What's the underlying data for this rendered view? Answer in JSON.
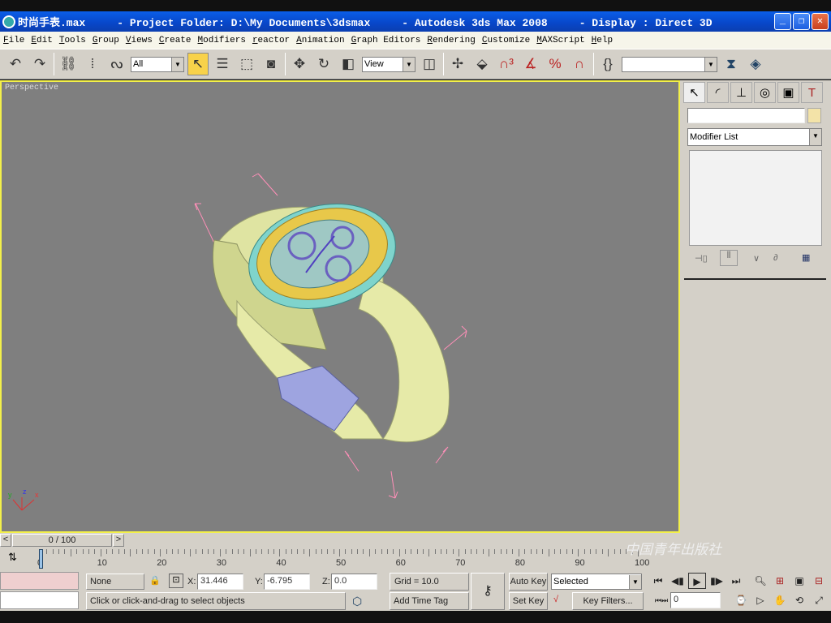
{
  "title_bar": {
    "title": "时尚手表.max     - Project Folder: D:\\My Documents\\3dsmax     - Autodesk 3ds Max 2008     - Display : Direct 3D",
    "minimize": "_",
    "restore": "❐",
    "close": "✕"
  },
  "menu": [
    "File",
    "Edit",
    "Tools",
    "Group",
    "Views",
    "Create",
    "Modifiers",
    "reactor",
    "Animation",
    "Graph Editors",
    "Rendering",
    "Customize",
    "MAXScript",
    "Help"
  ],
  "toolbar": {
    "selection_filter": "All",
    "reference_coord": "View",
    "named_selection": ""
  },
  "viewport": {
    "label": "Perspective",
    "axis": {
      "x": "x",
      "y": "y",
      "z": "z"
    }
  },
  "command_panel": {
    "tabs": [
      "create",
      "modify",
      "hierarchy",
      "motion",
      "display",
      "utilities"
    ],
    "object_name": "",
    "object_color": "#f3e3a8",
    "modifier_list": "Modifier List"
  },
  "time_slider": {
    "value": "0 / 100",
    "prev": "<",
    "next": ">"
  },
  "track_bar": {
    "ticks": [
      "0",
      "10",
      "20",
      "30",
      "40",
      "50",
      "60",
      "70",
      "80",
      "90",
      "100"
    ]
  },
  "watermark": "中国青年出版社",
  "status": {
    "selection": "None Selecte",
    "x_label": "X:",
    "x": "31.446",
    "y_label": "Y:",
    "y": "-6.795",
    "z_label": "Z:",
    "z": "0.0",
    "grid": "Grid = 10.0",
    "prompt": "Click or click-and-drag to select objects",
    "add_time_tag": "Add Time Tag",
    "auto_key": "Auto Key",
    "set_key": "Set Key",
    "key_mode": "Selected",
    "key_filters": "Key Filters...",
    "current_frame": "0"
  },
  "colors": {
    "viewport_bg": "#7f7f7f",
    "active_border": "#f3f04a",
    "bbox": "#ff8fb8",
    "bezel": "#e8c84a",
    "band": "#e6eaa8"
  }
}
